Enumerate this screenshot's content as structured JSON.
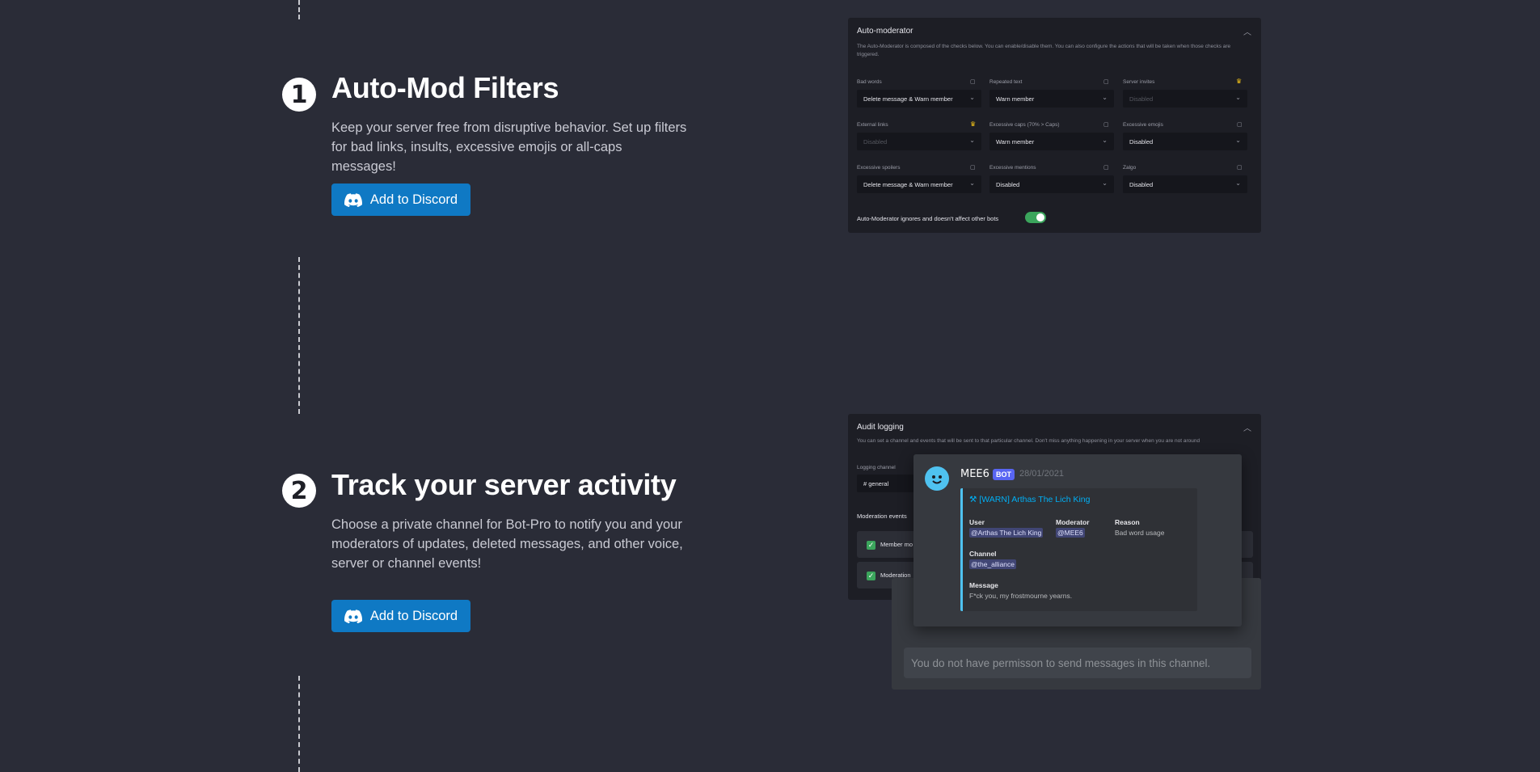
{
  "features": [
    {
      "number": "1",
      "title": "Auto-Mod Filters",
      "description": "Keep your server free from disruptive behavior. Set up filters for bad links, insults, excessive emojis or all-caps messages!",
      "button_label": "Add to Discord"
    },
    {
      "number": "2",
      "title": "Track your server activity",
      "description": "Choose a private channel for Bot-Pro to notify you and your moderators of updates, deleted messages, and other voice, server or channel events!",
      "button_label": "Add to Discord"
    }
  ],
  "automod": {
    "title": "Auto-moderator",
    "description": "The Auto-Moderator is composed of the checks below. You can enable/disable them. You can also configure the actions that will be taken when those checks are triggered.",
    "filters": [
      {
        "label": "Bad words",
        "value": "Delete message & Warn member",
        "disabled": false,
        "premium": false
      },
      {
        "label": "Repeated text",
        "value": "Warn member",
        "disabled": false,
        "premium": false
      },
      {
        "label": "Server invites",
        "value": "Disabled",
        "disabled": true,
        "premium": true
      },
      {
        "label": "External links",
        "value": "Disabled",
        "disabled": true,
        "premium": true
      },
      {
        "label": "Excessive caps (70% > Caps)",
        "value": "Warn member",
        "disabled": false,
        "premium": false
      },
      {
        "label": "Excessive emojis",
        "value": "Disabled",
        "disabled": false,
        "premium": false
      },
      {
        "label": "Excessive spoilers",
        "value": "Delete message & Warn member",
        "disabled": false,
        "premium": false
      },
      {
        "label": "Excessive mentions",
        "value": "Disabled",
        "disabled": false,
        "premium": false
      },
      {
        "label": "Zalgo",
        "value": "Disabled",
        "disabled": false,
        "premium": false
      }
    ],
    "toggle_label": "Auto-Moderator ignores and doesn't affect other bots",
    "toggle_on": true
  },
  "audit": {
    "title": "Audit logging",
    "description": "You can set a channel and events that will be sent to that particular channel. Don't miss anything happening in your server when you are not around",
    "channel_label": "Logging channel",
    "channel_value": "# general",
    "events_label": "Moderation events",
    "event_items": [
      "Member mo",
      "Moderation"
    ]
  },
  "discord_message": {
    "bot_name": "MEE6",
    "badge": "BOT",
    "date": "28/01/2021",
    "embed_title": "[WARN] Arthas The Lich King",
    "fields": {
      "user_label": "User",
      "user_value": "@Arthas The Lich King",
      "moderator_label": "Moderator",
      "moderator_value": "@MEE6",
      "reason_label": "Reason",
      "reason_value": "Bad word usage",
      "channel_label": "Channel",
      "channel_value": "@the_alliance",
      "message_label": "Message",
      "message_value": "F*ck you, my frostmourne yearns."
    },
    "input_placeholder": "You do not have permisson to send messages in this channel."
  },
  "icons": [
    "discord-icon",
    "chevron-up-icon",
    "chevron-down-icon",
    "crown-icon",
    "message-icon",
    "checkbox-icon",
    "avatar-icon"
  ],
  "colors": {
    "background": "#2a2c37",
    "button": "#0f79c4",
    "toggle": "#3ba55c",
    "link": "#00aff4",
    "badge": "#5865f2"
  }
}
